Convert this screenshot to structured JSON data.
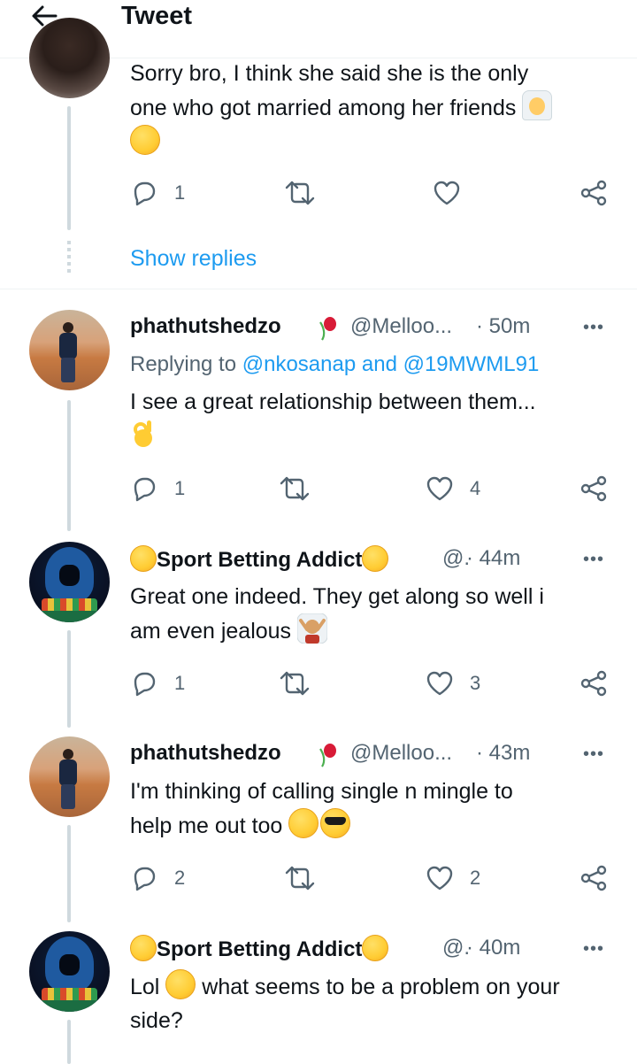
{
  "header": {
    "title": "Tweet"
  },
  "partial_reply": {
    "text_line1": "Sorry bro, I think she said she is the only",
    "text_line2": "one who got married among her friends",
    "actions": {
      "reply": "1",
      "retweet": "",
      "like": ""
    }
  },
  "show_replies": "Show replies",
  "tweets": [
    {
      "name": "phathutshedzo",
      "handle": "@Melloo...",
      "time": "· 50m",
      "replying_prefix": "Replying to ",
      "replying_to": "@nkosanap and @19MWML91",
      "text": "I see a great relationship between them...",
      "actions": {
        "reply": "1",
        "retweet": "",
        "like": "4"
      }
    },
    {
      "name": "Sport Betting Addict",
      "handle": "@.",
      "time": "· 44m",
      "text_line1": "Great one indeed. They get along so well i",
      "text_line2": "am even jealous",
      "actions": {
        "reply": "1",
        "retweet": "",
        "like": "3"
      }
    },
    {
      "name": "phathutshedzo",
      "handle": "@Melloo...",
      "time": "· 43m",
      "text_line1": "I'm thinking of calling single n mingle to",
      "text_line2": "help me out too",
      "actions": {
        "reply": "2",
        "retweet": "",
        "like": "2"
      }
    },
    {
      "name": "Sport Betting Addict",
      "handle": "@.",
      "time": "· 40m",
      "text_pre": "Lol",
      "text_post": "what seems to be a problem on your",
      "text_line2": "side?"
    }
  ],
  "more_icon": "•••",
  "colors": {
    "accent": "#1d9bf0",
    "muted": "#536471",
    "text": "#0f1419",
    "thread": "#cfd9de"
  },
  "icons": [
    "back-arrow-icon",
    "reply-icon",
    "retweet-icon",
    "like-icon",
    "share-icon",
    "more-icon"
  ]
}
